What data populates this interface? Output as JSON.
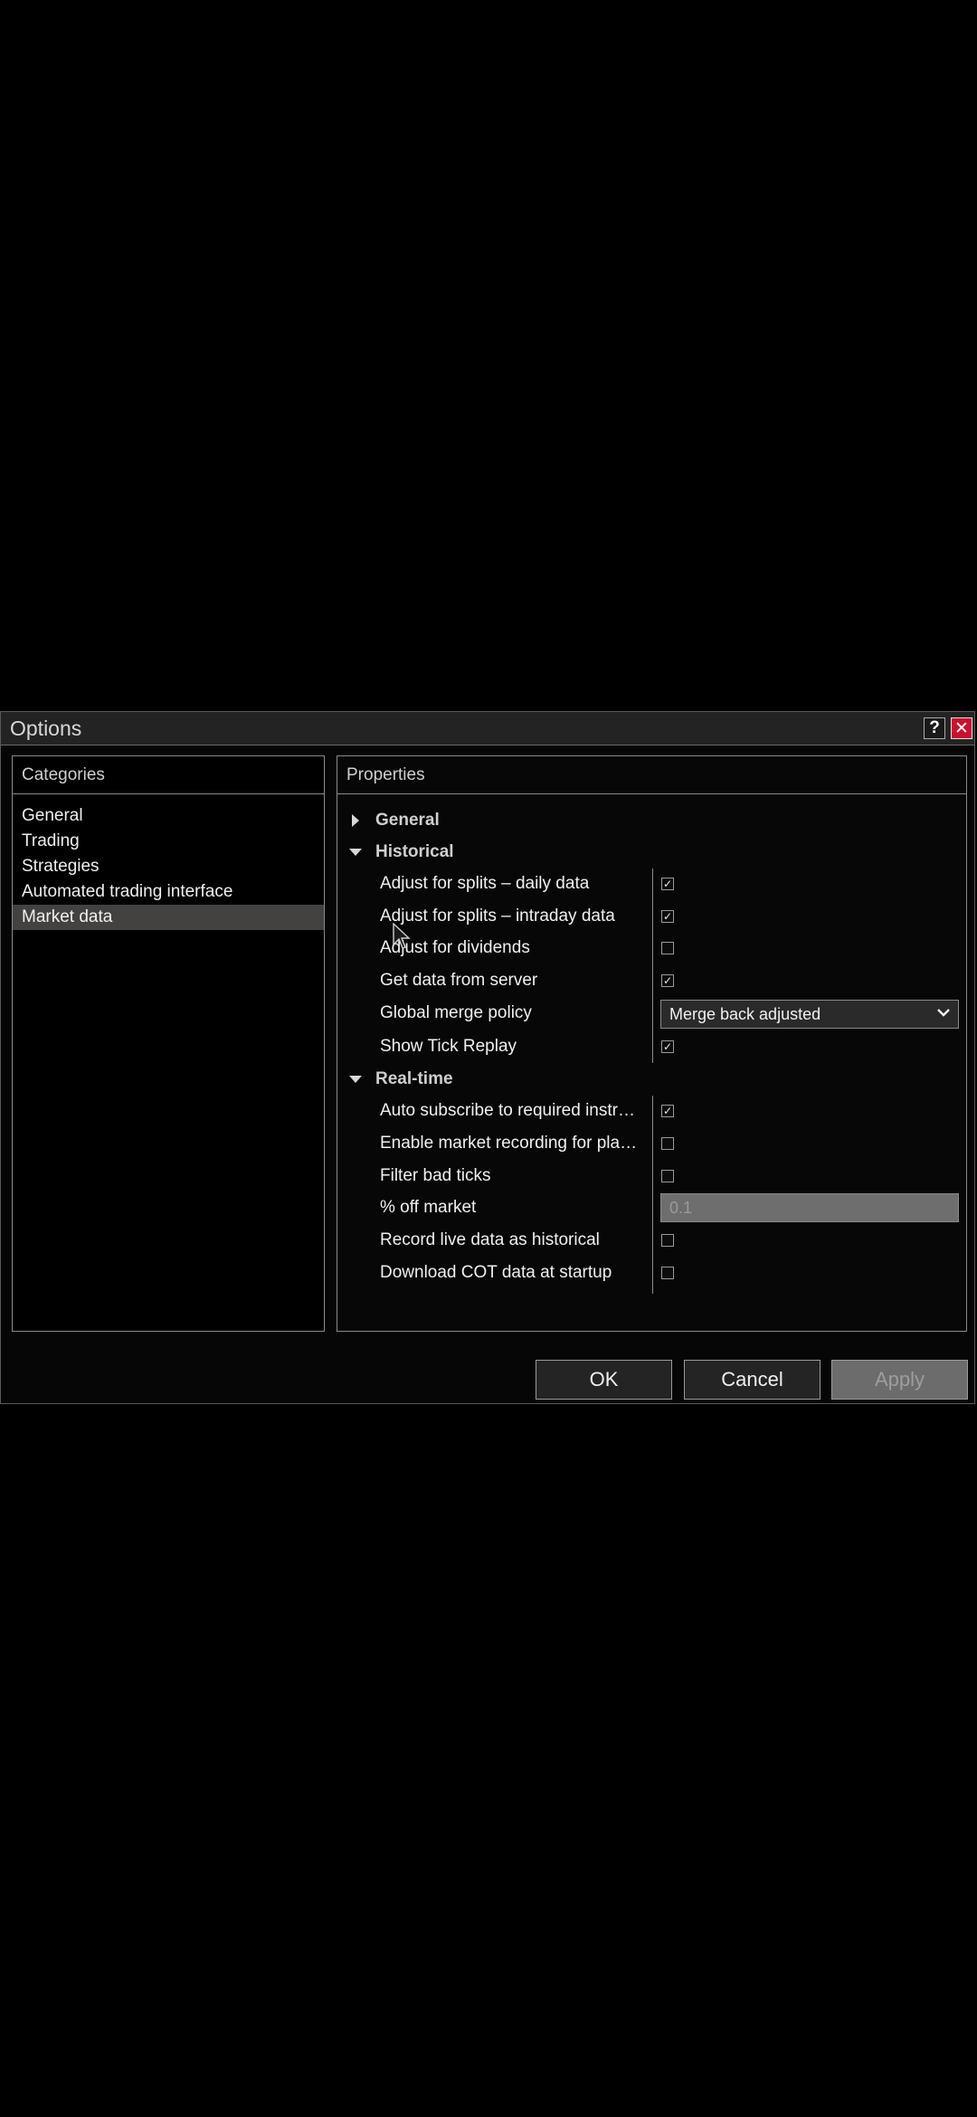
{
  "window": {
    "title": "Options",
    "help_label": "?",
    "close_label": "✕"
  },
  "categories": {
    "header": "Categories",
    "items": [
      {
        "label": "General"
      },
      {
        "label": "Trading"
      },
      {
        "label": "Strategies"
      },
      {
        "label": "Automated trading interface"
      },
      {
        "label": "Market data",
        "selected": true
      }
    ]
  },
  "properties": {
    "header": "Properties",
    "sections": {
      "general": {
        "label": "General",
        "expanded": false
      },
      "historical": {
        "label": "Historical",
        "expanded": true,
        "rows": [
          {
            "label": "Adjust for splits – daily data",
            "checked": true
          },
          {
            "label": "Adjust for splits – intraday data",
            "checked": true
          },
          {
            "label": "Adjust for dividends",
            "checked": false
          },
          {
            "label": "Get data from server",
            "checked": true
          },
          {
            "label": "Global merge policy",
            "value": "Merge back adjusted"
          },
          {
            "label": "Show Tick Replay",
            "checked": true
          }
        ]
      },
      "realtime": {
        "label": "Real-time",
        "expanded": true,
        "rows": [
          {
            "label": "Auto subscribe to required instru…",
            "checked": true
          },
          {
            "label": "Enable market recording for play…",
            "checked": false
          },
          {
            "label": "Filter bad ticks",
            "checked": false
          },
          {
            "label": "% off market",
            "value": "0.1"
          },
          {
            "label": "Record live data as historical",
            "checked": false
          },
          {
            "label": "Download COT data at startup",
            "checked": false
          }
        ]
      }
    }
  },
  "buttons": {
    "ok": "OK",
    "cancel": "Cancel",
    "apply": "Apply"
  },
  "check_mark": "✓",
  "dropdown_chevron": "⌄"
}
